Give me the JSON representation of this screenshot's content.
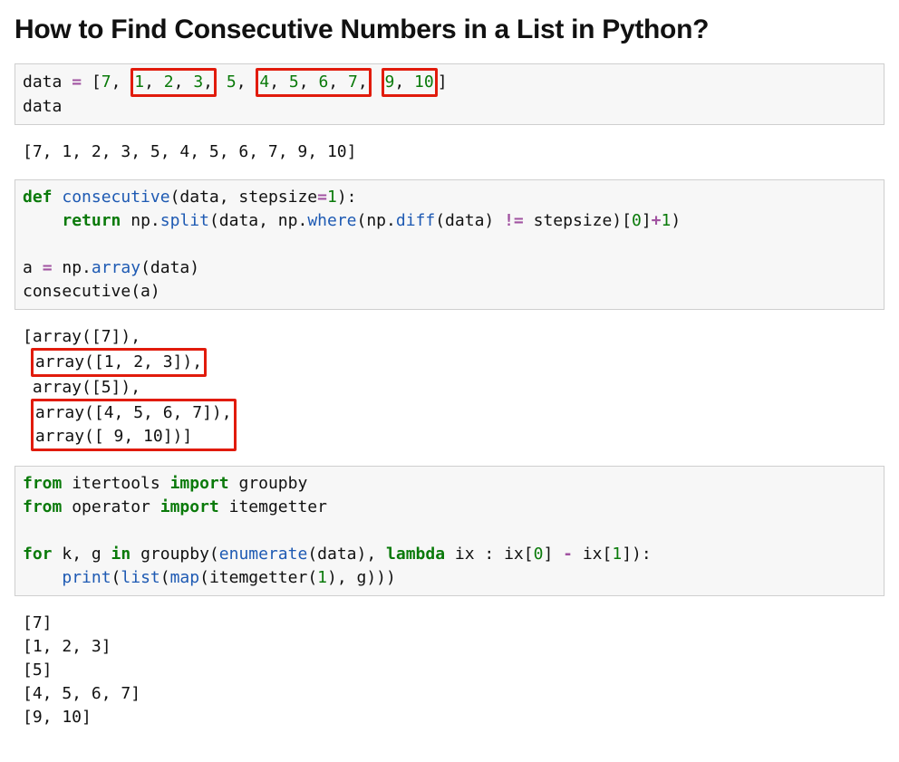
{
  "title": "How to Find Consecutive Numbers in a List in Python?",
  "cell1": {
    "prefix": "data ",
    "eq": "=",
    "openlist": " [",
    "n7": "7",
    "box1_n1": "1",
    "box1_n2": "2",
    "box1_n3": "3",
    "n5": "5",
    "box2_n4": "4",
    "box2_n5": "5",
    "box2_n6": "6",
    "box2_n7": "7",
    "box3_n9": "9",
    "box3_n10": "10",
    "closelist": "]",
    "line2": "data"
  },
  "out1": "[7, 1, 2, 3, 5, 4, 5, 6, 7, 9, 10]",
  "cell2": {
    "def": "def",
    "consecutive": "consecutive",
    "args_open": "(data, stepsize",
    "eq": "=",
    "one": "1",
    "args_close": "):",
    "indent": "    ",
    "return": "return",
    "np1": " np.",
    "split": "split",
    "open2": "(data, np.",
    "where": "where",
    "open3": "(np.",
    "diff": "diff",
    "open4": "(data) ",
    "neq": "!=",
    "step": " stepsize)[",
    "zero": "0",
    "close_idx": "]",
    "plus": "+",
    "one2": "1",
    "close_all": ")",
    "blank": "",
    "line4a": "a ",
    "eq2": "=",
    "line4b": " np.",
    "array": "array",
    "line4c": "(data)",
    "line5": "consecutive(a)"
  },
  "out2": {
    "l1": "[array([7]),",
    "l2": "array([1, 2, 3]),",
    "l3": " array([5]),",
    "l4": "array([4, 5, 6, 7]),",
    "l5": "array([ 9, 10])]"
  },
  "cell3": {
    "from": "from",
    "itertools": " itertools ",
    "import": "import",
    "groupby": " groupby",
    "operator": " operator ",
    "itemgetter": " itemgetter",
    "blank": "",
    "for": "for",
    "kg": " k, g ",
    "in": "in",
    "groupby_call": " groupby(",
    "enumerate": "enumerate",
    "enum_close": "(data), ",
    "lambda": "lambda",
    "ix": " ix : ix[",
    "zero": "0",
    "idxmid": "] ",
    "minus": "-",
    "ix2": " ix[",
    "one": "1",
    "idxend": "]):",
    "indent": "    ",
    "print": "print",
    "call2": "(",
    "list": "list",
    "call3": "(",
    "map": "map",
    "call4": "(itemgetter(",
    "one2": "1",
    "call5": "), g)))"
  },
  "out3": "[7]\n[1, 2, 3]\n[5]\n[4, 5, 6, 7]\n[9, 10]"
}
